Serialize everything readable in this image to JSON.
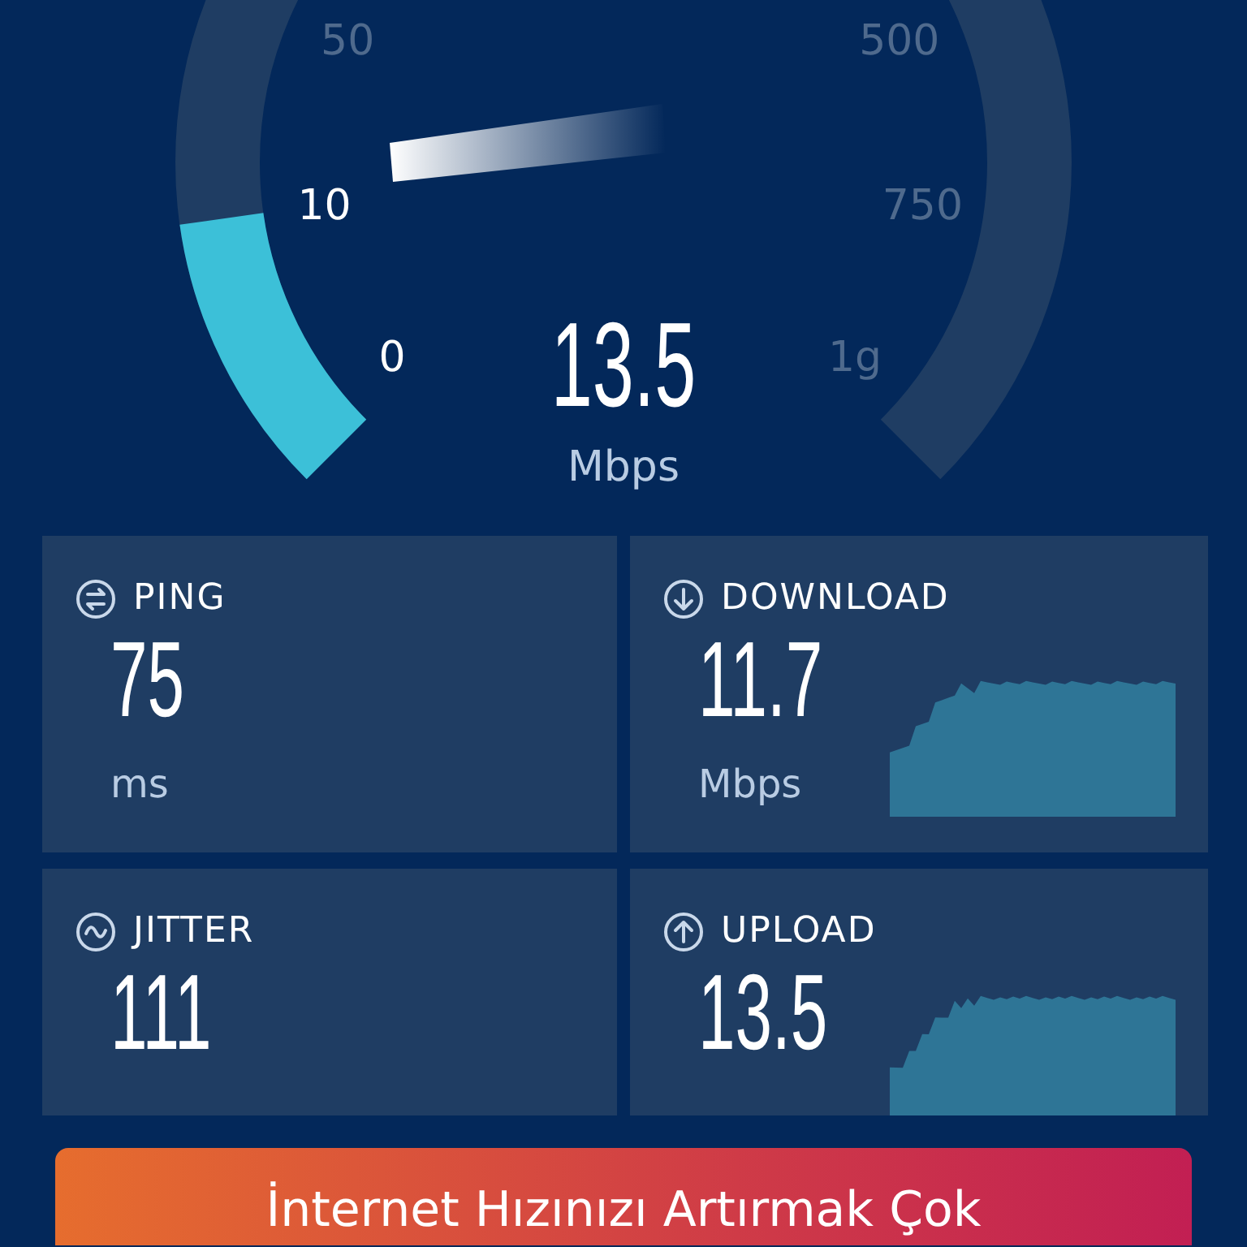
{
  "gauge": {
    "reading": "13.5",
    "unit": "Mbps",
    "scale": [
      {
        "label": "0",
        "reached": true
      },
      {
        "label": "10",
        "reached": true
      },
      {
        "label": "50",
        "reached": false
      },
      {
        "label": "500",
        "reached": false
      },
      {
        "label": "750",
        "reached": false
      },
      {
        "label": "1g",
        "reached": false
      }
    ]
  },
  "metrics": [
    {
      "kind": "ping",
      "label": "PING",
      "value": "75",
      "unit": "ms",
      "graph": false
    },
    {
      "kind": "download",
      "label": "DOWNLOAD",
      "value": "11.7",
      "unit": "Mbps",
      "graph": true
    },
    {
      "kind": "jitter",
      "label": "JITTER",
      "value": "111",
      "graph": false
    },
    {
      "kind": "upload",
      "label": "UPLOAD",
      "value": "13.5",
      "graph": true
    }
  ],
  "banner": {
    "text": "İnternet Hızınızı Artırmak Çok"
  }
}
